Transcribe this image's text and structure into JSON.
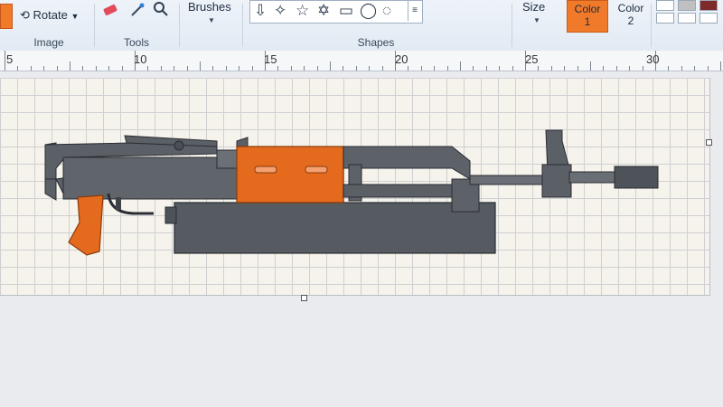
{
  "ribbon": {
    "image_group": {
      "rotate_label": "Rotate",
      "group_label": "Image"
    },
    "tools_group": {
      "group_label": "Tools"
    },
    "brushes_label": "Brushes",
    "shapes_group": {
      "group_label": "Shapes"
    },
    "size_label": "Size",
    "color1": {
      "label": "Color",
      "number": "1"
    },
    "color2": {
      "label": "Color",
      "number": "2"
    }
  },
  "ruler": {
    "marks": [
      "5",
      "10",
      "15",
      "20",
      "25",
      "30"
    ]
  },
  "colors": {
    "accent_orange": "#f07a2a",
    "gun_gray": "#5b5f66"
  }
}
